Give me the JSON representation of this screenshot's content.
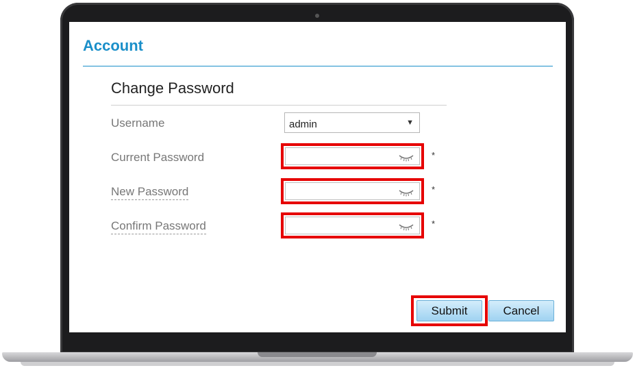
{
  "page": {
    "title": "Account",
    "section_title": "Change Password"
  },
  "form": {
    "username_label": "Username",
    "username_value": "admin",
    "current_password_label": "Current Password",
    "new_password_label": "New Password",
    "confirm_password_label": "Confirm Password",
    "required_marker": "*"
  },
  "actions": {
    "submit_label": "Submit",
    "cancel_label": "Cancel"
  },
  "colors": {
    "accent": "#1a8fc9",
    "highlight": "#e60000",
    "button": "#aadaf4"
  },
  "icons": {
    "dropdown": "chevron-down-icon",
    "password_toggle": "eye-closed-icon"
  }
}
